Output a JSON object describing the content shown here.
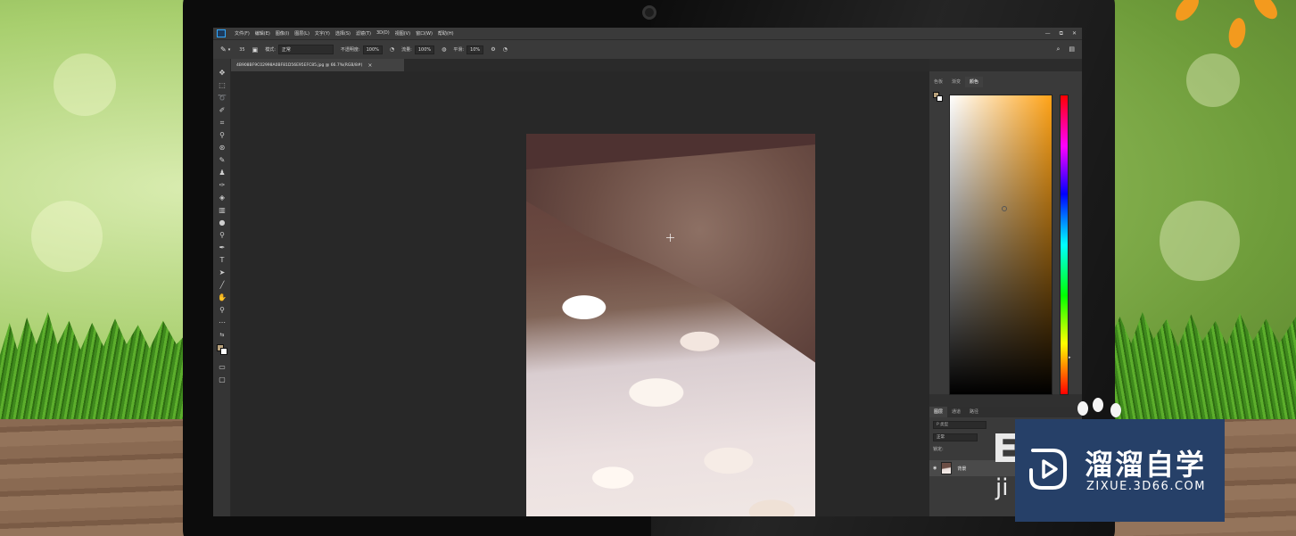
{
  "menubar": {
    "items": [
      "文件(F)",
      "编辑(E)",
      "图像(I)",
      "图层(L)",
      "文字(Y)",
      "选择(S)",
      "滤镜(T)",
      "3D(D)",
      "视图(V)",
      "窗口(W)",
      "帮助(H)"
    ],
    "window_controls": [
      "—",
      "⧉",
      "✕"
    ]
  },
  "options_bar": {
    "brush_size": "35",
    "mode_label": "模式:",
    "mode_value": "正常",
    "opacity_label": "不透明度:",
    "opacity_value": "100%",
    "flow_label": "流量:",
    "flow_value": "100%",
    "smoothing_label": "平滑:",
    "smoothing_value": "10%"
  },
  "document": {
    "tab_title": "4B908BF9C02998A0BF81D56E95EFC85.jpg @ 66.7%(RGB/8#)",
    "close_glyph": "×"
  },
  "color_panel": {
    "tabs": [
      "色板",
      "渐变",
      "颜色"
    ],
    "active_tab": "颜色",
    "foreground_color": "#b9a27c",
    "background_color": "#ffffff",
    "hue_color": "#ffa318"
  },
  "layers_panel": {
    "tabs": [
      "图层",
      "通道",
      "路径"
    ],
    "search_placeholder": "P 类型",
    "blend_mode": "正常",
    "lock_label": "锁定:",
    "layer_name": "背景"
  },
  "watermark": {
    "brand_cn": "溜溜自学",
    "brand_url": "ZIXUE.3D66.COM",
    "overlay_text_big": "E",
    "overlay_text_small": "ji"
  },
  "icons": [
    "move-icon",
    "marquee-icon",
    "lasso-icon",
    "quick-select-icon",
    "crop-icon",
    "eyedropper-icon",
    "healing-icon",
    "brush-icon",
    "stamp-icon",
    "history-brush-icon",
    "eraser-icon",
    "gradient-icon",
    "blur-icon",
    "dodge-icon",
    "pen-icon",
    "type-icon",
    "path-select-icon",
    "line-icon",
    "hand-icon",
    "zoom-icon",
    "more-tools-icon",
    "search-icon",
    "workspace-icon",
    "eye-icon"
  ]
}
